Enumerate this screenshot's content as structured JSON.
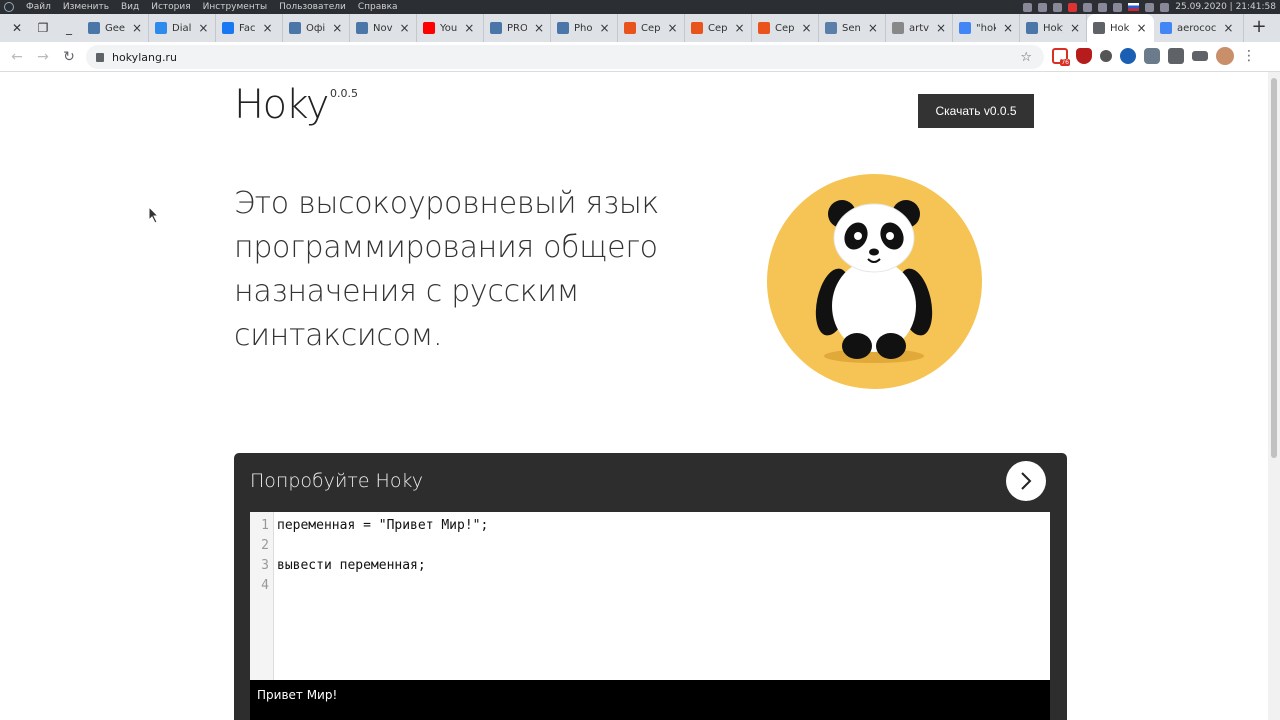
{
  "os": {
    "menu": [
      "Файл",
      "Изменить",
      "Вид",
      "История",
      "Инструменты",
      "Пользователи",
      "Справка"
    ],
    "datetime": "25.09.2020 | 21:41:58"
  },
  "tabs": [
    {
      "label": "Gee",
      "icon": "vk-icon",
      "color": "#4a76a8"
    },
    {
      "label": "Dial",
      "icon": "chat-icon",
      "color": "#2d8ceb"
    },
    {
      "label": "Fac",
      "icon": "facebook-icon",
      "color": "#1877f2"
    },
    {
      "label": "Офі",
      "icon": "vk-icon",
      "color": "#4a76a8"
    },
    {
      "label": "Nov",
      "icon": "vk-icon",
      "color": "#4a76a8"
    },
    {
      "label": "You",
      "icon": "youtube-icon",
      "color": "#ff0000"
    },
    {
      "label": "PRO",
      "icon": "vk-icon",
      "color": "#4a76a8"
    },
    {
      "label": "Pho",
      "icon": "vk-icon",
      "color": "#4a76a8"
    },
    {
      "label": "Сер",
      "icon": "brand-icon",
      "color": "#e8541c"
    },
    {
      "label": "Сер",
      "icon": "brand-icon",
      "color": "#e8541c"
    },
    {
      "label": "Сер",
      "icon": "brand-icon",
      "color": "#e8541c"
    },
    {
      "label": "Sen",
      "icon": "e-icon",
      "color": "#5a7fa8"
    },
    {
      "label": "artvid.r",
      "icon": "doc-icon",
      "color": "#888888"
    },
    {
      "label": "\"hoky\" я",
      "icon": "google-icon",
      "color": "#4285f4"
    },
    {
      "label": "Hoky (P",
      "icon": "vk-icon",
      "color": "#4a76a8"
    },
    {
      "label": "Hok",
      "icon": "globe-icon",
      "color": "#5f6368",
      "active": true
    },
    {
      "label": "aerococ",
      "icon": "google-icon",
      "color": "#4285f4"
    }
  ],
  "address": {
    "url": "hokylang.ru"
  },
  "extensions": {
    "gmail_badge": "76"
  },
  "page": {
    "logo": "Hoky",
    "version": "0.0.5",
    "download_label": "Скачать v0.0.5",
    "hero_lines": [
      "Это высокоуровневый язык",
      "программирования общего",
      "назначения с русским",
      "синтаксисом."
    ],
    "try": {
      "title": "Попробуйте Hoky",
      "line_numbers": [
        "1",
        "2",
        "3",
        "4"
      ],
      "code_lines": [
        "переменная = \"Привет Мир!\";",
        "",
        "вывести переменная;",
        ""
      ],
      "output": "Привет Мир!"
    }
  },
  "colors": {
    "panda_bg": "#f6c454",
    "dark_panel": "#2d2d2d",
    "button_dark": "#333333"
  }
}
